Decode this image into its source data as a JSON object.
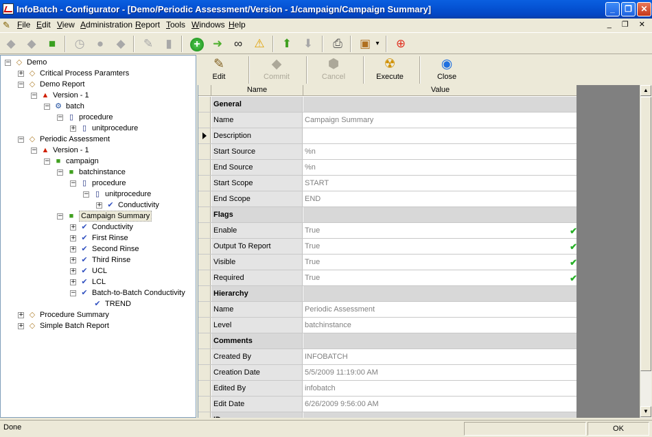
{
  "window": {
    "title": "InfoBatch - Configurator - [Demo/Periodic Assessment/Version - 1/campaign/Campaign Summary]",
    "minimize": "_",
    "restore": "❐",
    "close": "✕"
  },
  "menu": [
    "File",
    "Edit",
    "View",
    "Administration",
    "Report",
    "Tools",
    "Windows",
    "Help"
  ],
  "mdi_buttons": "_ ❐ ✕",
  "toolbar": {
    "icons": [
      "new-report-icon",
      "copy-icon",
      "cube-icon",
      "timer-icon",
      "circle-icon",
      "diamond-icon",
      "brush-icon",
      "database-icon",
      "add-icon",
      "refresh-icon",
      "find-icon",
      "warning-icon",
      "up-arrow-icon",
      "down-arrow-icon",
      "printer-icon",
      "install-icon",
      "dropdown-icon",
      "help-icon"
    ]
  },
  "tree": [
    {
      "label": "Demo",
      "depth": 0,
      "exp": "−",
      "icon": "report"
    },
    {
      "label": "Critical Process Paramters",
      "depth": 1,
      "exp": "+",
      "icon": "report"
    },
    {
      "label": "Demo Report",
      "depth": 1,
      "exp": "−",
      "icon": "report"
    },
    {
      "label": "Version - 1",
      "depth": 2,
      "exp": "−",
      "icon": "version"
    },
    {
      "label": "batch",
      "depth": 3,
      "exp": "−",
      "icon": "batch"
    },
    {
      "label": "procedure",
      "depth": 4,
      "exp": "−",
      "icon": "proc"
    },
    {
      "label": "unitprocedure",
      "depth": 5,
      "exp": "+",
      "icon": "proc"
    },
    {
      "label": "Periodic Assessment",
      "depth": 1,
      "exp": "−",
      "icon": "report"
    },
    {
      "label": "Version - 1",
      "depth": 2,
      "exp": "−",
      "icon": "version"
    },
    {
      "label": "campaign",
      "depth": 3,
      "exp": "−",
      "icon": "cube"
    },
    {
      "label": "batchinstance",
      "depth": 4,
      "exp": "−",
      "icon": "cube"
    },
    {
      "label": "procedure",
      "depth": 5,
      "exp": "−",
      "icon": "proc"
    },
    {
      "label": "unitprocedure",
      "depth": 6,
      "exp": "−",
      "icon": "proc"
    },
    {
      "label": "Conductivity",
      "depth": 7,
      "exp": "+",
      "icon": "chart"
    },
    {
      "label": "Campaign Summary",
      "depth": 4,
      "exp": "−",
      "icon": "cube",
      "selected": true
    },
    {
      "label": "Conductivity",
      "depth": 5,
      "exp": "+",
      "icon": "chart"
    },
    {
      "label": "First Rinse",
      "depth": 5,
      "exp": "+",
      "icon": "chart"
    },
    {
      "label": "Second Rinse",
      "depth": 5,
      "exp": "+",
      "icon": "chart"
    },
    {
      "label": "Third Rinse",
      "depth": 5,
      "exp": "+",
      "icon": "chart"
    },
    {
      "label": "UCL",
      "depth": 5,
      "exp": "+",
      "icon": "chart"
    },
    {
      "label": "LCL",
      "depth": 5,
      "exp": "+",
      "icon": "chart"
    },
    {
      "label": "Batch-to-Batch Conductivity",
      "depth": 5,
      "exp": "−",
      "icon": "chart"
    },
    {
      "label": "TREND",
      "depth": 6,
      "exp": "",
      "icon": "chart"
    },
    {
      "label": "Procedure Summary",
      "depth": 1,
      "exp": "+",
      "icon": "report"
    },
    {
      "label": "Simple Batch Report",
      "depth": 1,
      "exp": "+",
      "icon": "report"
    }
  ],
  "panel_toolbar": [
    {
      "label": "Edit",
      "icon": "edit-icon",
      "enabled": true
    },
    {
      "label": "Commit",
      "icon": "commit-icon",
      "enabled": false
    },
    {
      "label": "Cancel",
      "icon": "cancel-icon",
      "enabled": false
    },
    {
      "label": "Execute",
      "icon": "execute-icon",
      "enabled": true
    },
    {
      "label": "Close",
      "icon": "close-icon",
      "enabled": true
    }
  ],
  "grid": {
    "columns": [
      "Name",
      "Value"
    ],
    "rows": [
      {
        "section": true,
        "name": "General",
        "value": ""
      },
      {
        "name": "Name",
        "value": "Campaign Summary"
      },
      {
        "name": "Description",
        "value": "",
        "current": true
      },
      {
        "name": "Start Source",
        "value": "%n"
      },
      {
        "name": "End Source",
        "value": "%n"
      },
      {
        "name": "Start Scope",
        "value": "START"
      },
      {
        "name": "End Scope",
        "value": "END"
      },
      {
        "section": true,
        "name": "Flags",
        "value": ""
      },
      {
        "name": "Enable",
        "value": "True",
        "checked": true
      },
      {
        "name": "Output To Report",
        "value": "True",
        "checked": true
      },
      {
        "name": "Visible",
        "value": "True",
        "checked": true
      },
      {
        "name": "Required",
        "value": "True",
        "checked": true
      },
      {
        "section": true,
        "name": "Hierarchy",
        "value": ""
      },
      {
        "name": "Name",
        "value": "Periodic Assessment"
      },
      {
        "name": "Level",
        "value": "batchinstance"
      },
      {
        "section": true,
        "name": "Comments",
        "value": ""
      },
      {
        "name": "Created By",
        "value": "INFOBATCH"
      },
      {
        "name": "Creation Date",
        "value": "5/5/2009 11:19:00 AM"
      },
      {
        "name": "Edited By",
        "value": "infobatch"
      },
      {
        "name": "Edit Date",
        "value": "6/26/2009 9:56:00 AM"
      },
      {
        "section": true,
        "name": "ID",
        "value": ""
      }
    ]
  },
  "status": {
    "text": "Done",
    "pane_right": "OK"
  }
}
